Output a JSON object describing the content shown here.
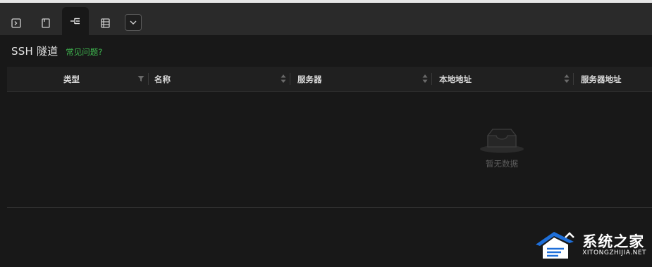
{
  "tabs": [
    {
      "icon": "terminal-icon",
      "active": false
    },
    {
      "icon": "file-icon",
      "active": false
    },
    {
      "icon": "network-tree-icon",
      "active": true
    },
    {
      "icon": "list-icon",
      "active": false
    }
  ],
  "dropdown": {
    "icon": "chevron-down-icon"
  },
  "header": {
    "title": "SSH 隧道",
    "faq_link": "常见问题?"
  },
  "table": {
    "columns": [
      "类型",
      "名称",
      "服务器",
      "本地地址",
      "服务器地址"
    ],
    "rows": [],
    "empty_text": "暂无数据",
    "empty_icon": "inbox-icon"
  },
  "watermark": {
    "main": "系统之家",
    "sub": "XITONGZHIJIA.NET"
  },
  "colors": {
    "accent_link": "#3fb950",
    "background": "#181818",
    "tabbar": "#2a2a2a"
  }
}
